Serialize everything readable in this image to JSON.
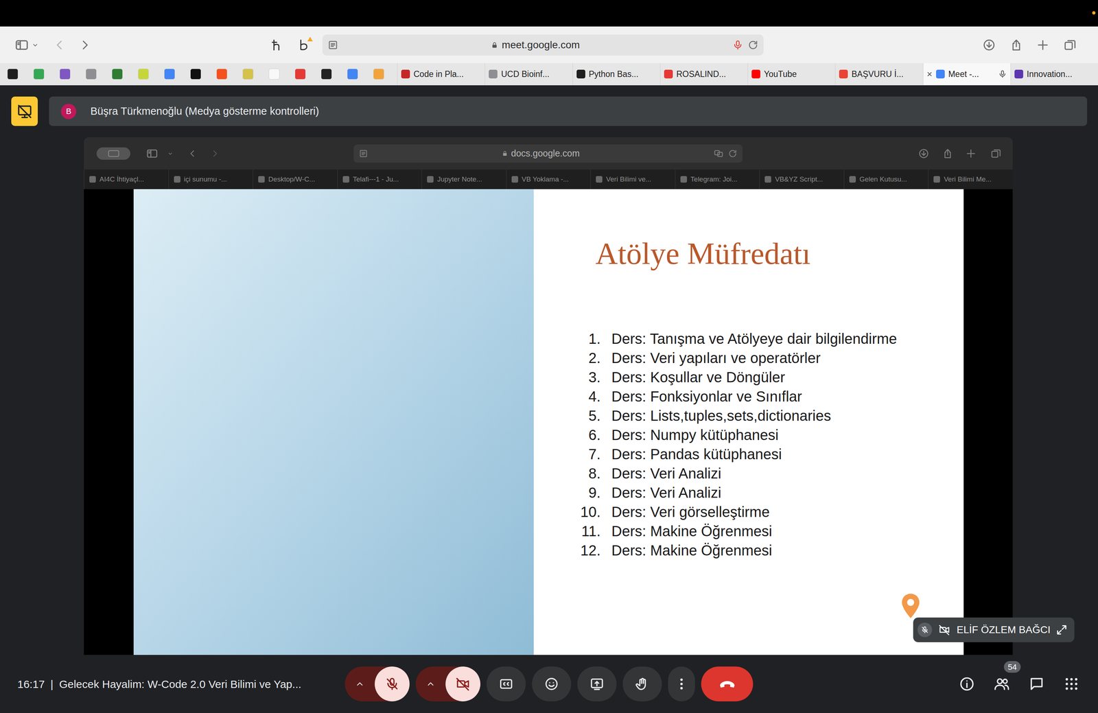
{
  "browser": {
    "url": "meet.google.com",
    "tabs": [
      {
        "label": "Code in Pla...",
        "selected": false
      },
      {
        "label": "UCD Bioinf...",
        "selected": false
      },
      {
        "label": "Python Bas...",
        "selected": false
      },
      {
        "label": "ROSALIND...",
        "selected": false
      },
      {
        "label": "YouTube",
        "selected": false
      },
      {
        "label": "BAŞVURU İ...",
        "selected": false
      },
      {
        "label": "Meet -...",
        "selected": true,
        "close": "×"
      },
      {
        "label": "Innovation...",
        "selected": false
      }
    ]
  },
  "presentation_banner": {
    "avatar": "B",
    "text": "Büşra Türkmenoğlu (Medya gösterme kontrolleri)"
  },
  "shared_screen": {
    "url": "docs.google.com",
    "tabs": [
      {
        "label": "AI4C İhtiyaçl...",
        "selected": false
      },
      {
        "label": "içi sunumu -...",
        "selected": false
      },
      {
        "label": "Desktop/W-C...",
        "selected": false
      },
      {
        "label": "Telafi---1 - Ju...",
        "selected": false
      },
      {
        "label": "Jupyter Note...",
        "selected": false
      },
      {
        "label": "VB Yoklama -...",
        "selected": false
      },
      {
        "label": "Veri Bilimi ve...",
        "selected": false
      },
      {
        "label": "Telegram: Joi...",
        "selected": false
      },
      {
        "label": "VB&YZ Script...",
        "selected": false
      },
      {
        "label": "Gelen Kutusu...",
        "selected": false
      },
      {
        "label": "Veri Bilimi Me...",
        "selected": false
      }
    ],
    "slide": {
      "title": "Atölye Müfredatı",
      "items": [
        {
          "number": "1.",
          "text": "Ders: Tanışma ve Atölyeye dair bilgilendirme"
        },
        {
          "number": "2.",
          "text": "Ders: Veri yapıları ve operatörler"
        },
        {
          "number": "3.",
          "text": "Ders: Koşullar ve Döngüler"
        },
        {
          "number": "4.",
          "text": "Ders: Fonksiyonlar ve Sınıflar"
        },
        {
          "number": "5.",
          "text": "Ders: Lists,tuples,sets,dictionaries"
        },
        {
          "number": "6.",
          "text": "Ders: Numpy kütüphanesi"
        },
        {
          "number": "7.",
          "text": "Ders: Pandas kütüphanesi"
        },
        {
          "number": "8.",
          "text": "Ders: Veri Analizi"
        },
        {
          "number": "9.",
          "text": "Ders: Veri Analizi"
        },
        {
          "number": "10.",
          "text": "Ders: Veri görselleştirme"
        },
        {
          "number": "11.",
          "text": "Ders: Makine Öğrenmesi"
        },
        {
          "number": "12.",
          "text": "Ders: Makine Öğrenmesi"
        }
      ]
    }
  },
  "participant_tile": {
    "name": "ELİF ÖZLEM BAĞCI",
    "muted": true,
    "camera_off": true
  },
  "bottom_bar": {
    "time": "16:17",
    "separator": "|",
    "meeting_title": "Gelecek Hayalim: W-Code 2.0 Veri Bilimi ve Yap...",
    "mic_muted": true,
    "camera_off": true,
    "participant_count": "54"
  }
}
